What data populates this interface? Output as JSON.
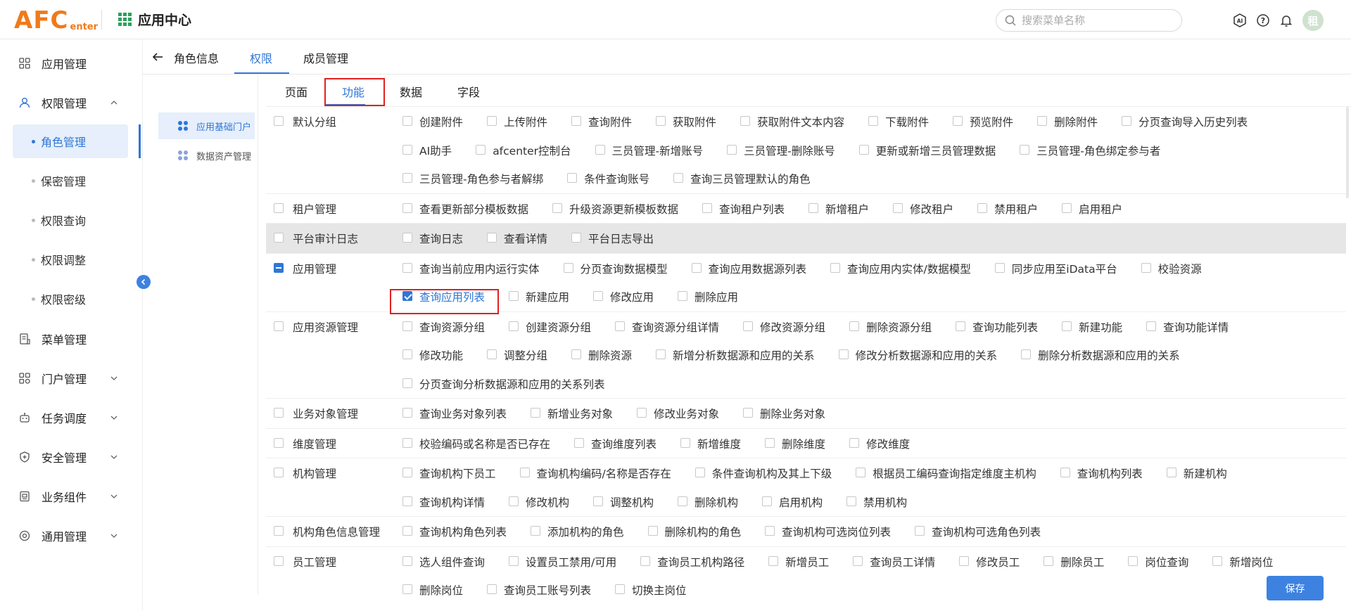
{
  "header": {
    "logo_main": "AFC",
    "logo_sub": "enter",
    "app_title": "应用中心",
    "search_placeholder": "搜索菜单名称",
    "avatar_text": "租"
  },
  "sidebar": {
    "items": [
      {
        "label": "应用管理",
        "icon": "apps-icon"
      },
      {
        "label": "权限管理",
        "icon": "user-icon",
        "expanded": true
      },
      {
        "label": "菜单管理",
        "icon": "menu-doc-icon"
      },
      {
        "label": "门户管理",
        "icon": "portal-icon"
      },
      {
        "label": "任务调度",
        "icon": "robot-icon"
      },
      {
        "label": "安全管理",
        "icon": "shield-icon"
      },
      {
        "label": "业务组件",
        "icon": "component-icon"
      },
      {
        "label": "通用管理",
        "icon": "settings-icon"
      }
    ],
    "sub_items": [
      "角色管理",
      "保密管理",
      "权限查询",
      "权限调整",
      "权限密级"
    ],
    "active_sub": "角色管理"
  },
  "top_tabs": [
    "角色信息",
    "权限",
    "成员管理"
  ],
  "active_top_tab": "权限",
  "tree": [
    "应用基础门户",
    "数据资产管理"
  ],
  "sub_tabs": [
    "页面",
    "功能",
    "数据",
    "字段"
  ],
  "active_sub_tab": "功能",
  "permissions": [
    {
      "category": "默认分组",
      "lines": [
        [
          "创建附件",
          "上传附件",
          "查询附件",
          "获取附件",
          "获取附件文本内容",
          "下载附件",
          "预览附件",
          "删除附件",
          "分页查询导入历史列表"
        ],
        [
          "AI助手",
          "afcenter控制台",
          "三员管理-新增账号",
          "三员管理-删除账号",
          "更新或新增三员管理数据",
          "三员管理-角色绑定参与者"
        ],
        [
          "三员管理-角色参与者解绑",
          "条件查询账号",
          "查询三员管理默认的角色"
        ]
      ]
    },
    {
      "category": "租户管理",
      "lines": [
        [
          "查看更新部分模板数据",
          "升级资源更新模板数据",
          "查询租户列表",
          "新增租户",
          "修改租户",
          "禁用租户",
          "启用租户"
        ]
      ]
    },
    {
      "category": "平台审计日志",
      "lines": [
        [
          "查询日志",
          "查看详情",
          "平台日志导出"
        ]
      ]
    },
    {
      "category": "应用管理",
      "lines": [
        [
          "查询当前应用内运行实体",
          "分页查询数据模型",
          "查询应用数据源列表",
          "查询应用内实体/数据模型",
          "同步应用至iData平台",
          "校验资源"
        ],
        [
          "查询应用列表",
          "新建应用",
          "修改应用",
          "删除应用"
        ]
      ]
    },
    {
      "category": "应用资源管理",
      "lines": [
        [
          "查询资源分组",
          "创建资源分组",
          "查询资源分组详情",
          "修改资源分组",
          "删除资源分组",
          "查询功能列表",
          "新建功能",
          "查询功能详情"
        ],
        [
          "修改功能",
          "调整分组",
          "删除资源",
          "新增分析数据源和应用的关系",
          "修改分析数据源和应用的关系",
          "删除分析数据源和应用的关系"
        ],
        [
          "分页查询分析数据源和应用的关系列表"
        ]
      ]
    },
    {
      "category": "业务对象管理",
      "lines": [
        [
          "查询业务对象列表",
          "新增业务对象",
          "修改业务对象",
          "删除业务对象"
        ]
      ]
    },
    {
      "category": "维度管理",
      "lines": [
        [
          "校验编码或名称是否已存在",
          "查询维度列表",
          "新增维度",
          "删除维度",
          "修改维度"
        ]
      ]
    },
    {
      "category": "机构管理",
      "lines": [
        [
          "查询机构下员工",
          "查询机构编码/名称是否存在",
          "条件查询机构及其上下级",
          "根据员工编码查询指定维度主机构",
          "查询机构列表",
          "新建机构"
        ],
        [
          "查询机构详情",
          "修改机构",
          "调整机构",
          "删除机构",
          "启用机构",
          "禁用机构"
        ]
      ]
    },
    {
      "category": "机构角色信息管理",
      "lines": [
        [
          "查询机构角色列表",
          "添加机构的角色",
          "删除机构的角色",
          "查询机构可选岗位列表",
          "查询机构可选角色列表"
        ]
      ]
    },
    {
      "category": "员工管理",
      "lines": [
        [
          "选人组件查询",
          "设置员工禁用/可用",
          "查询员工机构路径",
          "新增员工",
          "查询员工详情",
          "修改员工",
          "删除员工",
          "岗位查询",
          "新增岗位"
        ],
        [
          "删除岗位",
          "查询员工账号列表",
          "切换主岗位"
        ]
      ]
    }
  ],
  "checked_items": [
    "查询应用列表"
  ],
  "indeterminate_categories": [
    "应用管理"
  ],
  "save_label": "保存",
  "colors": {
    "accent": "#2f77d6",
    "logo": "#f07a1a",
    "highlight": "#e02020"
  }
}
